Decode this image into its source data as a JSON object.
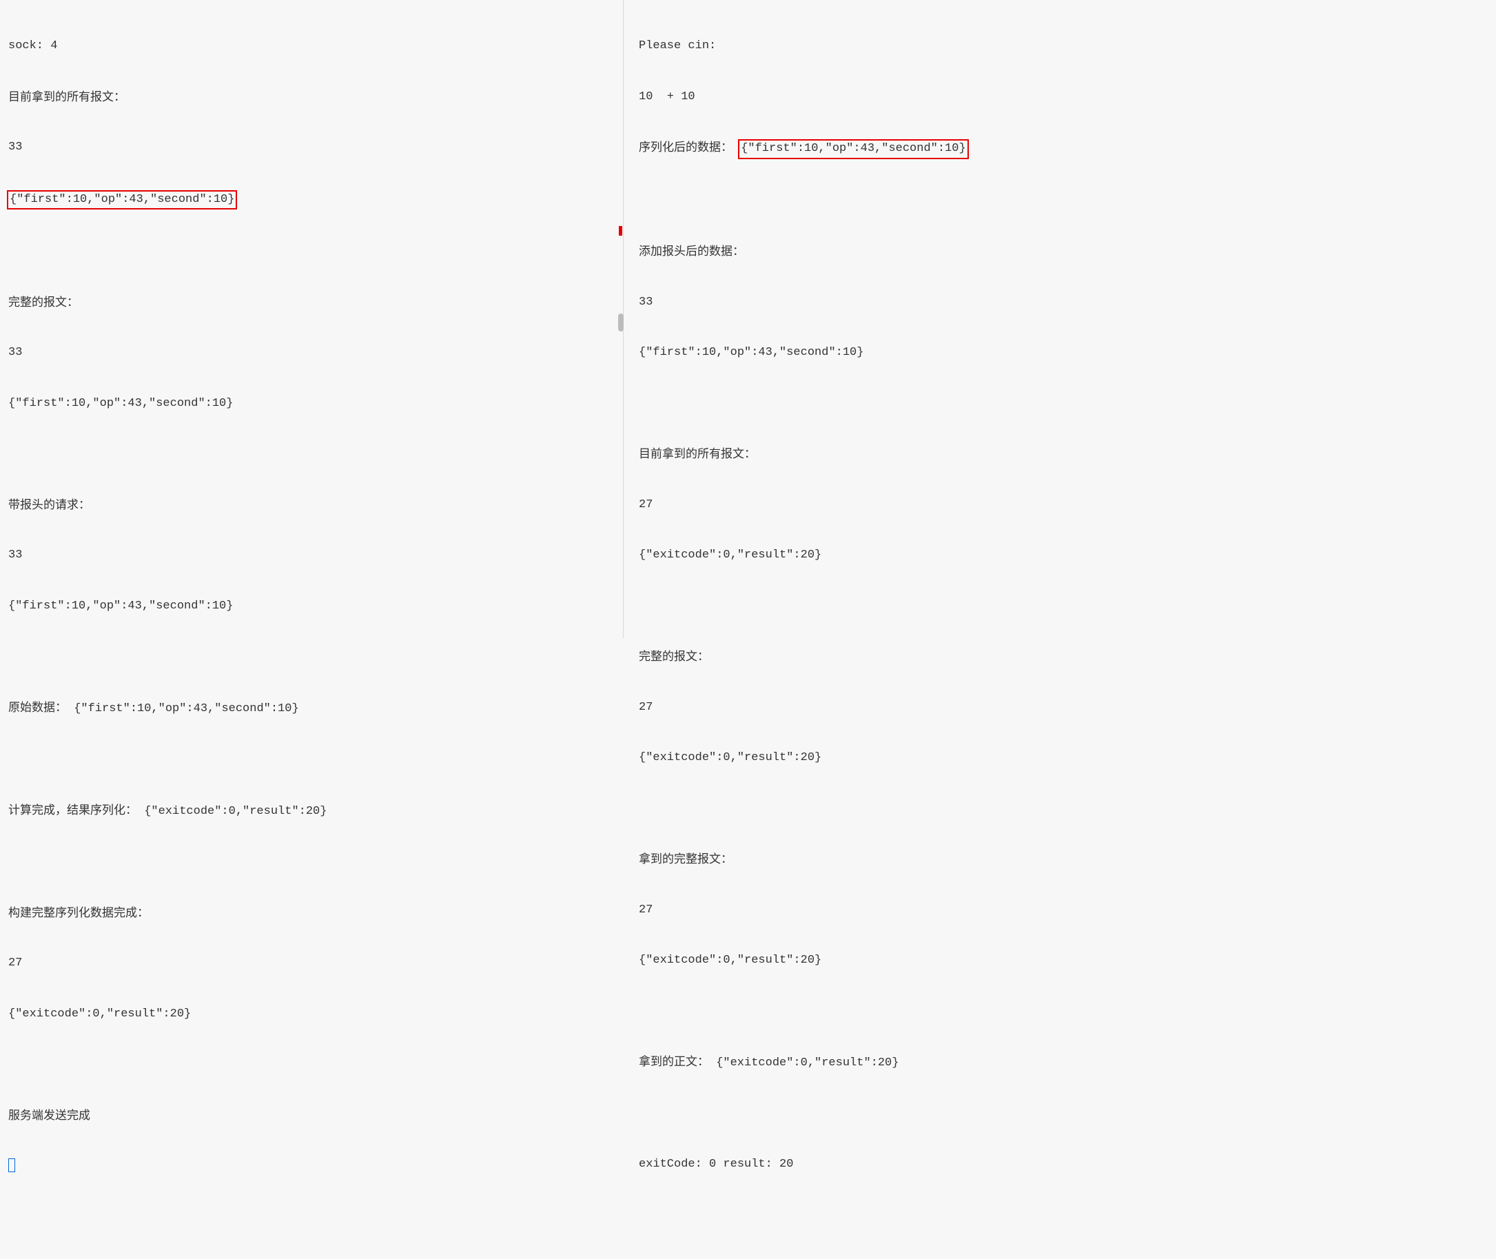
{
  "left": {
    "l1": "sock: 4",
    "l2": "目前拿到的所有报文：",
    "l3": "33",
    "l4": "{\"first\":10,\"op\":43,\"second\":10}",
    "l5": "",
    "l6": "完整的报文：",
    "l7": "33",
    "l8": "{\"first\":10,\"op\":43,\"second\":10}",
    "l9": "",
    "l10": "带报头的请求：",
    "l11": "33",
    "l12": "{\"first\":10,\"op\":43,\"second\":10}",
    "l13": "",
    "l14a": "原始数据：",
    "l14b": "{\"first\":10,\"op\":43,\"second\":10}",
    "l15": "",
    "l16a": "计算完成，结果序列化：",
    "l16b": "{\"exitcode\":0,\"result\":20}",
    "l17": "",
    "l18": "构建完整序列化数据完成：",
    "l19": "27",
    "l20": "{\"exitcode\":0,\"result\":20}",
    "l21": "",
    "l22": "服务端发送完成"
  },
  "right": {
    "r1": "Please cin:",
    "r2": "10  + 10",
    "r3a": "序列化后的数据：",
    "r3b": "{\"first\":10,\"op\":43,\"second\":10}",
    "r4": "",
    "r5": "添加报头后的数据：",
    "r6": "33",
    "r7": "{\"first\":10,\"op\":43,\"second\":10}",
    "r8": "",
    "r9": "目前拿到的所有报文：",
    "r10": "27",
    "r11": "{\"exitcode\":0,\"result\":20}",
    "r12": "",
    "r13": "完整的报文：",
    "r14": "27",
    "r15": "{\"exitcode\":0,\"result\":20}",
    "r16": "",
    "r17": "拿到的完整报文：",
    "r18": "27",
    "r19": "{\"exitcode\":0,\"result\":20}",
    "r20": "",
    "r21a": "拿到的正文：",
    "r21b": "{\"exitcode\":0,\"result\":20}",
    "r22": "",
    "r23": "exitCode: 0 result: 20"
  }
}
